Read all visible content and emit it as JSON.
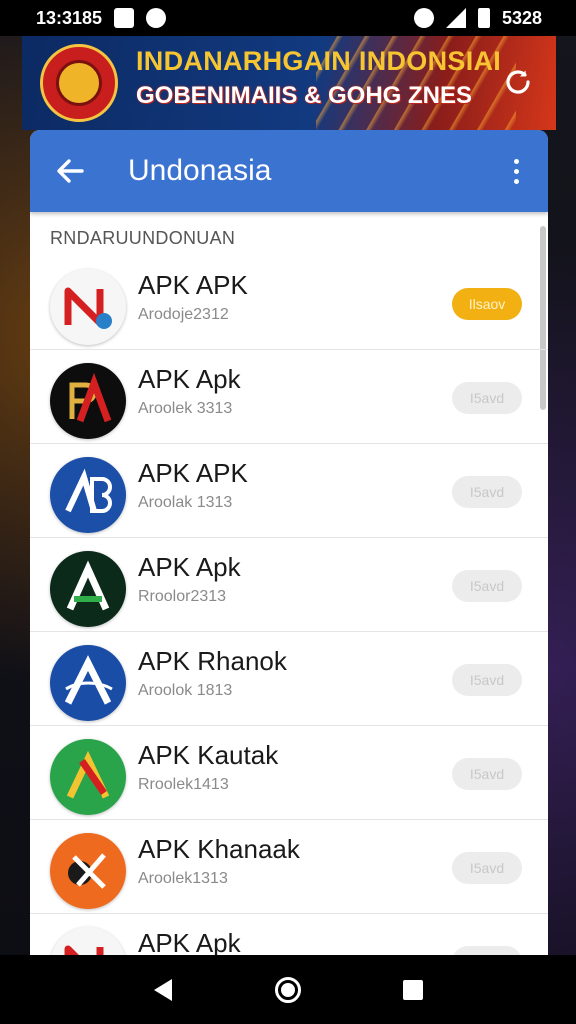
{
  "status_bar": {
    "time": "13:3185",
    "right_text": "5328",
    "icons": [
      "notification-icon",
      "notification-icon-2",
      "alarm-icon",
      "signal-icon",
      "battery-icon"
    ]
  },
  "banner": {
    "title": "INDANARHGAIN INDONSIAI",
    "subtitle": "GOBENIMAIIS & GOHG ZNES",
    "colors": {
      "title": "#f7c531",
      "background": "#123a80",
      "accent": "#d6371a"
    }
  },
  "app_bar": {
    "title": "Undonasia",
    "color": "#3b73d0"
  },
  "section": {
    "header": "RNDARUUNDONUAN"
  },
  "apps": [
    {
      "name": "APK APK",
      "meta": "Arodoje2312",
      "action": "Ilsaov",
      "icon": "app-icon-red-n",
      "glyph": "N",
      "primary": true
    },
    {
      "name": "APK Apk",
      "meta": "Aroolek 3313",
      "action": "I5avd",
      "icon": "app-icon-black-pa",
      "glyph": "A",
      "primary": false
    },
    {
      "name": "APK APK",
      "meta": "Aroolak 1313",
      "action": "I5avd",
      "icon": "app-icon-blue-ab",
      "glyph": "A",
      "primary": false
    },
    {
      "name": "APK Apk",
      "meta": "Rroolor2313",
      "action": "I5avd",
      "icon": "app-icon-green-a",
      "glyph": "A",
      "primary": false
    },
    {
      "name": "APK Rhanok",
      "meta": "Aroolok 1813",
      "action": "I5avd",
      "icon": "app-icon-blue-a",
      "glyph": "A",
      "primary": false
    },
    {
      "name": "APK Kautak",
      "meta": "Rroolek1413",
      "action": "I5avd",
      "icon": "app-icon-green-k",
      "glyph": "A",
      "primary": false
    },
    {
      "name": "APK Khanaak",
      "meta": "Aroolek1313",
      "action": "I5avd",
      "icon": "app-icon-orange-x",
      "glyph": "X",
      "primary": false
    },
    {
      "name": "APK Apk",
      "meta": "",
      "action": "",
      "icon": "app-icon-red-n",
      "glyph": "N",
      "primary": false
    }
  ],
  "colors": {
    "primary_button": "#f2b012",
    "disabled_button": "#ececec"
  }
}
